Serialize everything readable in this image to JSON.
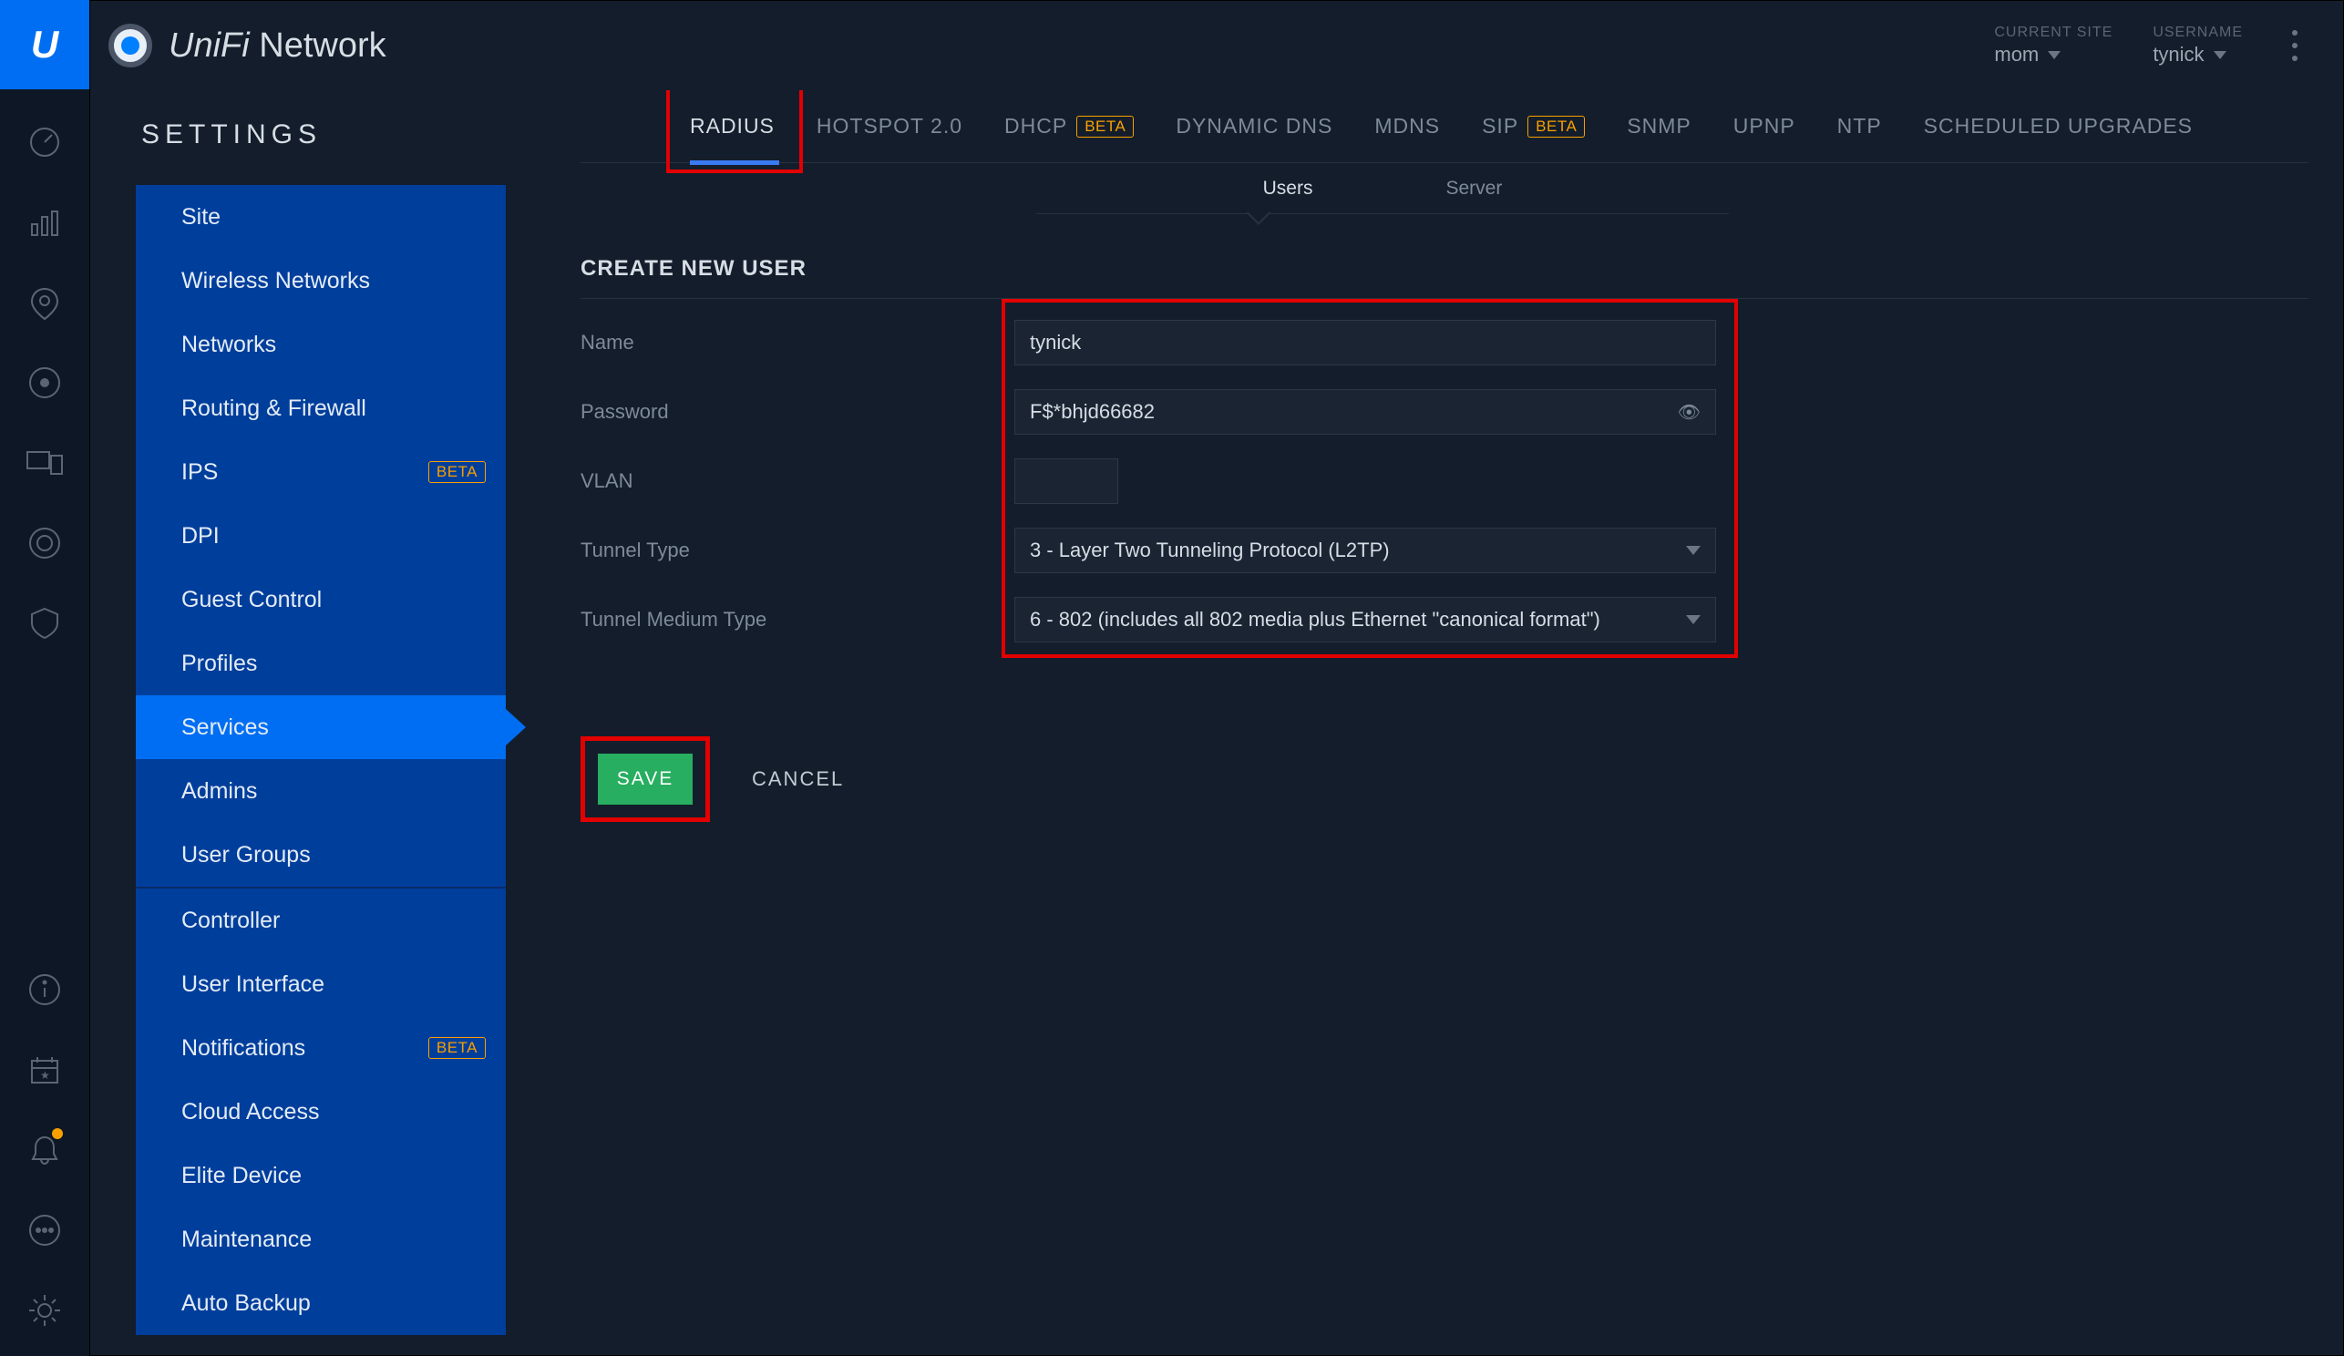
{
  "brand": {
    "logo_text": "U",
    "name_italic": "UniFi",
    "name_rest": " Network"
  },
  "header": {
    "site_label": "CURRENT SITE",
    "site_value": "mom",
    "user_label": "USERNAME",
    "user_value": "tynick"
  },
  "settings_title": "SETTINGS",
  "nav": {
    "items": [
      "Site",
      "Wireless Networks",
      "Networks",
      "Routing & Firewall",
      "IPS",
      "DPI",
      "Guest Control",
      "Profiles",
      "Services",
      "Admins",
      "User Groups"
    ],
    "items2": [
      "Controller",
      "User Interface",
      "Notifications",
      "Cloud Access",
      "Elite Device",
      "Maintenance",
      "Auto Backup"
    ],
    "badge_beta": "BETA",
    "active": "Services"
  },
  "top_tabs": {
    "items": [
      "RADIUS",
      "HOTSPOT 2.0",
      "DHCP",
      "DYNAMIC DNS",
      "MDNS",
      "SIP",
      "SNMP",
      "UPNP",
      "NTP",
      "SCHEDULED UPGRADES"
    ],
    "active": "RADIUS",
    "badge_beta": "BETA"
  },
  "subtabs": {
    "users": "Users",
    "server": "Server"
  },
  "section": {
    "title": "CREATE NEW USER"
  },
  "form": {
    "name_label": "Name",
    "name_value": "tynick",
    "password_label": "Password",
    "password_value": "F$*bhjd66682",
    "vlan_label": "VLAN",
    "vlan_value": "",
    "tunnel_type_label": "Tunnel Type",
    "tunnel_type_value": "3 - Layer Two Tunneling Protocol (L2TP)",
    "tunnel_medium_label": "Tunnel Medium Type",
    "tunnel_medium_value": "6 - 802 (includes all 802 media plus Ethernet \"canonical format\")"
  },
  "actions": {
    "save": "SAVE",
    "cancel": "CANCEL"
  },
  "colors": {
    "accent": "#006ef3",
    "danger_box": "#e20000",
    "save_green": "#27ae60",
    "beta_orange": "#f7a000"
  }
}
